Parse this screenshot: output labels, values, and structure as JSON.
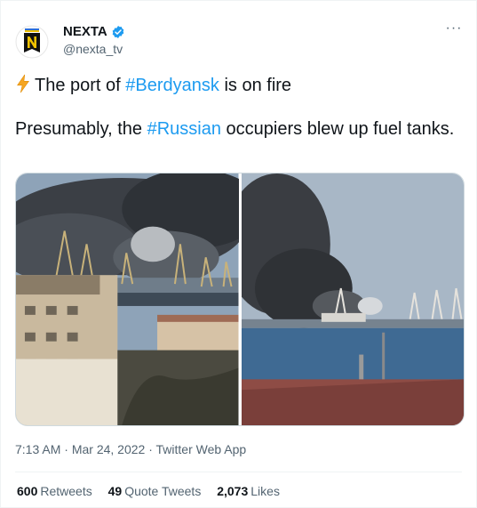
{
  "author": {
    "name": "NEXTA",
    "handle": "@nexta_tv"
  },
  "tweet": {
    "line1_prefix": "The port of ",
    "line1_hashtag": "#Berdyansk",
    "line1_suffix": " is on fire",
    "line2_prefix": "Presumably, the ",
    "line2_hashtag": "#Russian",
    "line2_suffix": " occupiers blew up fuel tanks."
  },
  "meta": {
    "time": "7:13 AM",
    "sep1": " · ",
    "date": "Mar 24, 2022",
    "sep2": " · ",
    "source": "Twitter Web App"
  },
  "stats": {
    "retweets_count": "600",
    "retweets_label": "Retweets",
    "quotes_count": "49",
    "quotes_label": "Quote Tweets",
    "likes_count": "2,073",
    "likes_label": "Likes"
  },
  "icons": {
    "verified": "verified-badge-icon",
    "bolt": "lightning-bolt-icon",
    "more": "more-options-icon"
  },
  "colors": {
    "accent": "#1d9bf0",
    "text": "#0f1419",
    "muted": "#536471"
  }
}
